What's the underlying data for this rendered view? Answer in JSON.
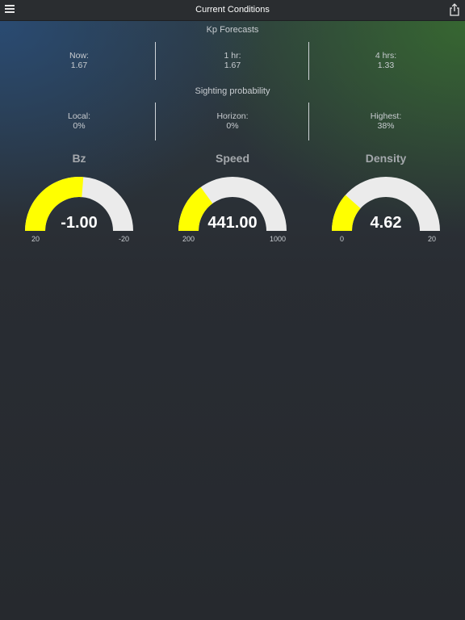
{
  "app": {
    "title": "Current Conditions",
    "menu_icon": "hamburger-menu-icon",
    "share_icon": "share-icon"
  },
  "kp_forecasts": {
    "title": "Kp Forecasts",
    "items": [
      {
        "label": "Now:",
        "value": "1.67"
      },
      {
        "label": "1 hr:",
        "value": "1.67"
      },
      {
        "label": "4 hrs:",
        "value": "1.33"
      }
    ]
  },
  "sighting": {
    "title": "Sighting probability",
    "items": [
      {
        "label": "Local:",
        "value": "0%"
      },
      {
        "label": "Horizon:",
        "value": "0%"
      },
      {
        "label": "Highest:",
        "value": "38%"
      }
    ]
  },
  "gauges": [
    {
      "title": "Bz",
      "value": "-1.00",
      "min_label": "20",
      "max_label": "-20",
      "level": 0.525
    },
    {
      "title": "Speed",
      "value": "441.00",
      "min_label": "200",
      "max_label": "1000",
      "level": 0.3
    },
    {
      "title": "Density",
      "value": "4.62",
      "min_label": "0",
      "max_label": "20",
      "level": 0.231
    }
  ],
  "colors": {
    "gauge_fill": "#ffff00",
    "gauge_track": "#ebebeb",
    "topbar": "#2a2d30",
    "background": "#26292e"
  }
}
